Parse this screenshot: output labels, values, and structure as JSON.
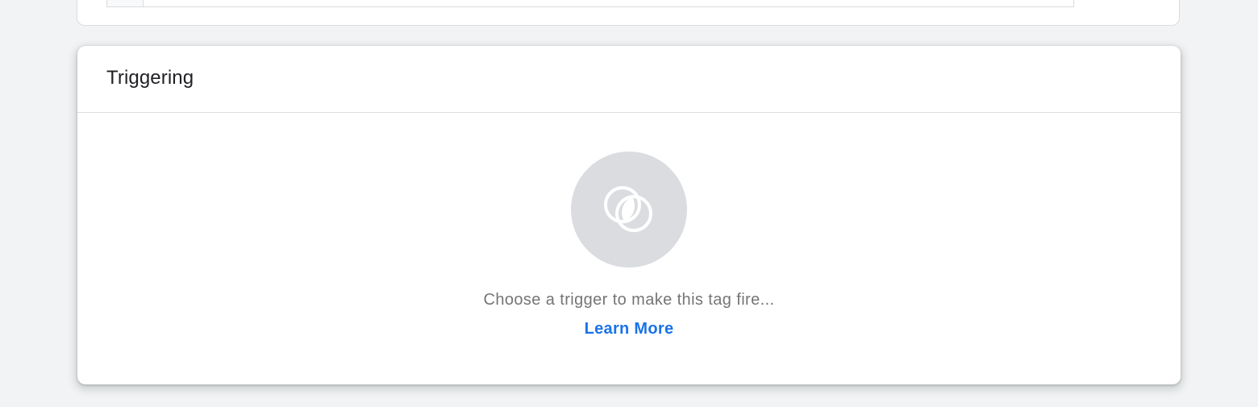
{
  "triggering_card": {
    "title": "Triggering",
    "trigger_icon": "trigger-overlap-circles-icon",
    "hint": "Choose a trigger to make this tag fire...",
    "learn_more_label": "Learn More"
  },
  "colors": {
    "background": "#f1f3f4",
    "card": "#ffffff",
    "icon_circle": "#dadce0",
    "hint_text": "#757575",
    "link": "#1a73e8",
    "title_text": "#202124"
  }
}
